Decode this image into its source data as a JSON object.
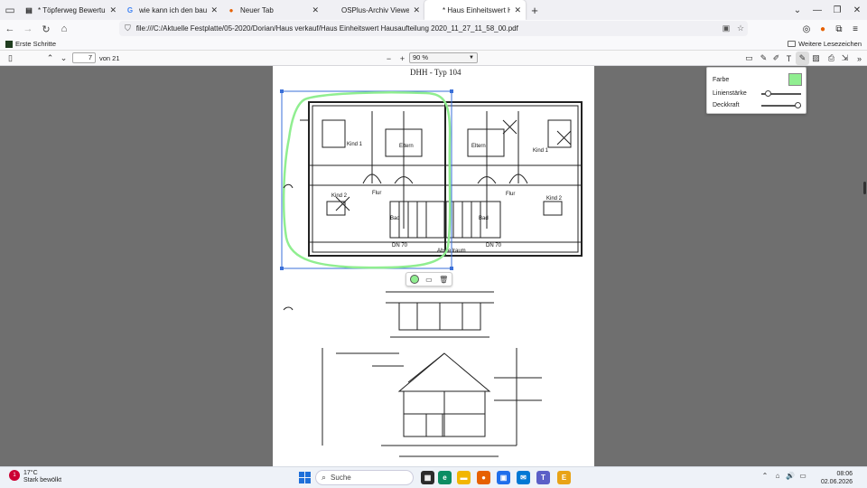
{
  "tabs": [
    {
      "title": "* Töpferweg Bewertung PP - Töpfer",
      "favicon": "doc-icon",
      "color": "#555555"
    },
    {
      "title": "wie kann ich den baupreisindex",
      "favicon": "google-icon",
      "color": "#4285f4"
    },
    {
      "title": "Neuer Tab",
      "favicon": "firefox-icon",
      "color": "#e66000"
    },
    {
      "title": "OSPlus-Archiv Viewer - Liegenschaft",
      "favicon": "blank",
      "color": "#ffffff"
    },
    {
      "title": "* Haus Einheitswert Hausaufteilung",
      "favicon": "blank",
      "color": "#ffffff"
    }
  ],
  "url": "file:///C:/Aktuelle Festplatte/05-2020/Dorian/Haus verkauf/Haus Einheitswert Hausaufteilung 2020_11_27_11_58_00.pdf",
  "bookmarks": {
    "first": "Erste Schritte",
    "more": "Weitere Lesezeichen"
  },
  "pdf": {
    "page": "7",
    "of": "von 21",
    "zoom": "90 %"
  },
  "ink_panel": {
    "color_label": "Farbe",
    "thickness_label": "Linienstärke",
    "opacity_label": "Deckkraft",
    "color": "#90ee90",
    "thickness": 0.15,
    "opacity": 1.0
  },
  "taskbar": {
    "temp": "17°C",
    "weather": "Stark bewölkt",
    "search_label": "Suche",
    "time": "08:06",
    "date": "02.06.2026"
  },
  "plan_text": {
    "header": "DHH - Typ 104",
    "rooms": [
      "Kind 1",
      "Eltern",
      "Eltern",
      "Kind 1",
      "Kind 2",
      "Flur",
      "Flur",
      "Kind 2",
      "Bad",
      "Bad",
      "DN 70",
      "DN 70",
      "Abstellraum"
    ]
  },
  "colors": {
    "ink": "#90ee90",
    "accent": "#0060df"
  }
}
